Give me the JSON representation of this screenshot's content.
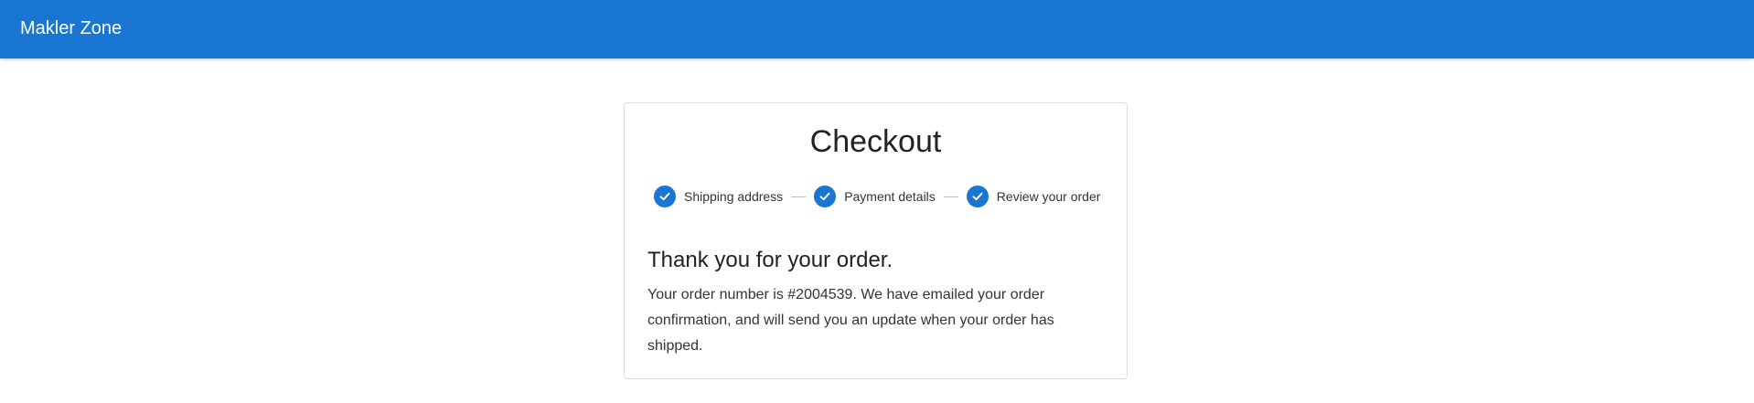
{
  "app": {
    "title": "Makler Zone",
    "accent_color": "#1976d2"
  },
  "checkout": {
    "title": "Checkout",
    "steps": [
      {
        "label": "Shipping address",
        "completed": true,
        "icon": "check-circle-icon"
      },
      {
        "label": "Payment details",
        "completed": true,
        "icon": "check-circle-icon"
      },
      {
        "label": "Review your order",
        "completed": true,
        "icon": "check-circle-icon"
      }
    ],
    "confirmation": {
      "heading": "Thank you for your order.",
      "message": "Your order number is #2004539. We have emailed your order confirmation, and will send you an update when your order has shipped."
    }
  }
}
